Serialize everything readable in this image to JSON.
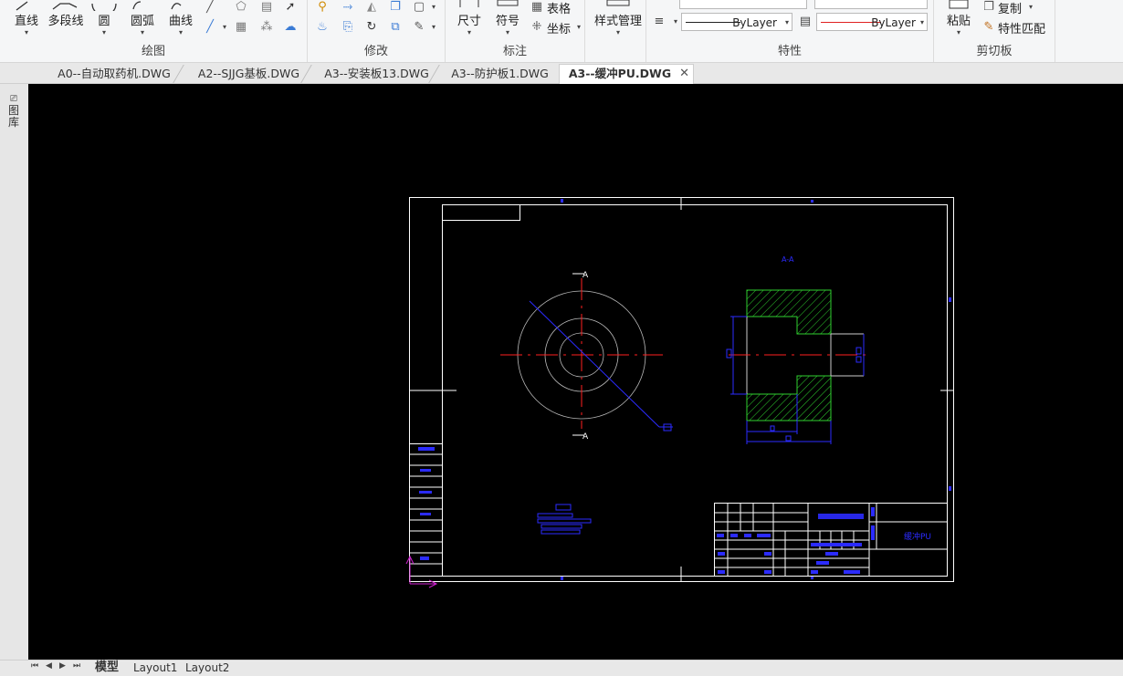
{
  "ribbon": {
    "draw": {
      "label": "绘图",
      "line": "直线",
      "polyline": "多段线",
      "circle": "圆",
      "arc": "圆弧",
      "curve": "曲线"
    },
    "modify": {
      "label": "修改"
    },
    "annotate": {
      "label": "标注",
      "dimension": "尺寸",
      "symbol": "符号",
      "table": "表格",
      "coordinate": "坐标"
    },
    "style": {
      "label": "样式管理"
    },
    "properties": {
      "label": "特性",
      "linetype_value": "ByLayer",
      "lineweight_value": "ByLayer"
    },
    "clipboard": {
      "label": "剪切板",
      "paste": "粘贴",
      "copy": "复制",
      "match": "特性匹配"
    }
  },
  "tabs": [
    {
      "label": "A0--自动取药机.DWG"
    },
    {
      "label": "A2--SJJG基板.DWG"
    },
    {
      "label": "A3--安装板13.DWG"
    },
    {
      "label": "A3--防护板1.DWG"
    },
    {
      "label": "A3--缓冲PU.DWG",
      "active": true
    }
  ],
  "left_panel": {
    "label": "图库"
  },
  "drawing": {
    "section_label": "A-A",
    "cut_label": "A",
    "title_block_text": "缓冲PU"
  },
  "layout_tabs": [
    {
      "label": "模型",
      "active": true
    },
    {
      "label": "Layout1"
    },
    {
      "label": "Layout2"
    }
  ],
  "colors": {
    "canvas_bg": "#000000",
    "border": "#ffffff",
    "center_line": "#ff2020",
    "dimension": "#2b2bff",
    "hatch": "#2fd02f",
    "ucs": "#d020d0"
  }
}
